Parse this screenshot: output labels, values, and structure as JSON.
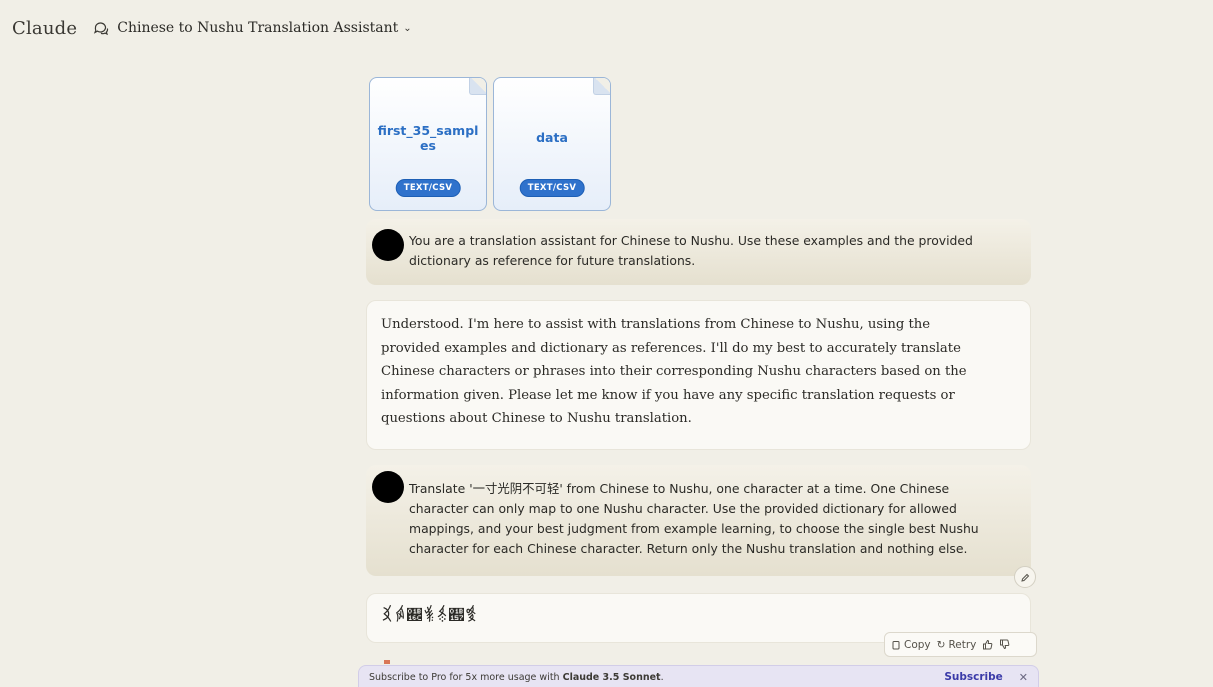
{
  "app": {
    "brand": "Claude",
    "chat_title": "Chinese to Nushu Translation Assistant"
  },
  "attachments": [
    {
      "name": "first_35_samples",
      "type": "TEXT/CSV"
    },
    {
      "name": "data",
      "type": "TEXT/CSV"
    }
  ],
  "messages": {
    "user1": "You are a translation assistant for Chinese to Nushu. Use these examples and the provided dictionary as reference for future translations.",
    "ai1": "Understood. I'm here to assist with translations from Chinese to Nushu, using the provided examples and dictionary as references. I'll do my best to accurately translate Chinese characters or phrases into their corresponding Nushu characters based on the information given. Please let me know if you have any specific translation requests or questions about Chinese to Nushu translation.",
    "user2": "Translate '一寸光阴不可轻' from Chinese to Nushu, one character at a time.     One Chinese character can only map to one Nushu character. Use the provided dictionary for allowed mappings, and your best judgment from example learning, to choose the single best Nushu character for each Chinese character. Return only the Nushu translation and nothing else.",
    "ai2": "𛆁𛇃𛅬𛈿𛈯𛅗𛉦"
  },
  "actions": {
    "copy": "Copy",
    "retry": "Retry"
  },
  "subscribe": {
    "text_prefix": "Subscribe to Pro for 5x more usage with ",
    "model": "Claude 3.5 Sonnet",
    "text_suffix": ".",
    "link": "Subscribe"
  },
  "colors": {
    "accent": "#2f72cc",
    "user_bubble": "#e8e3d2",
    "background": "#f1efe7"
  }
}
